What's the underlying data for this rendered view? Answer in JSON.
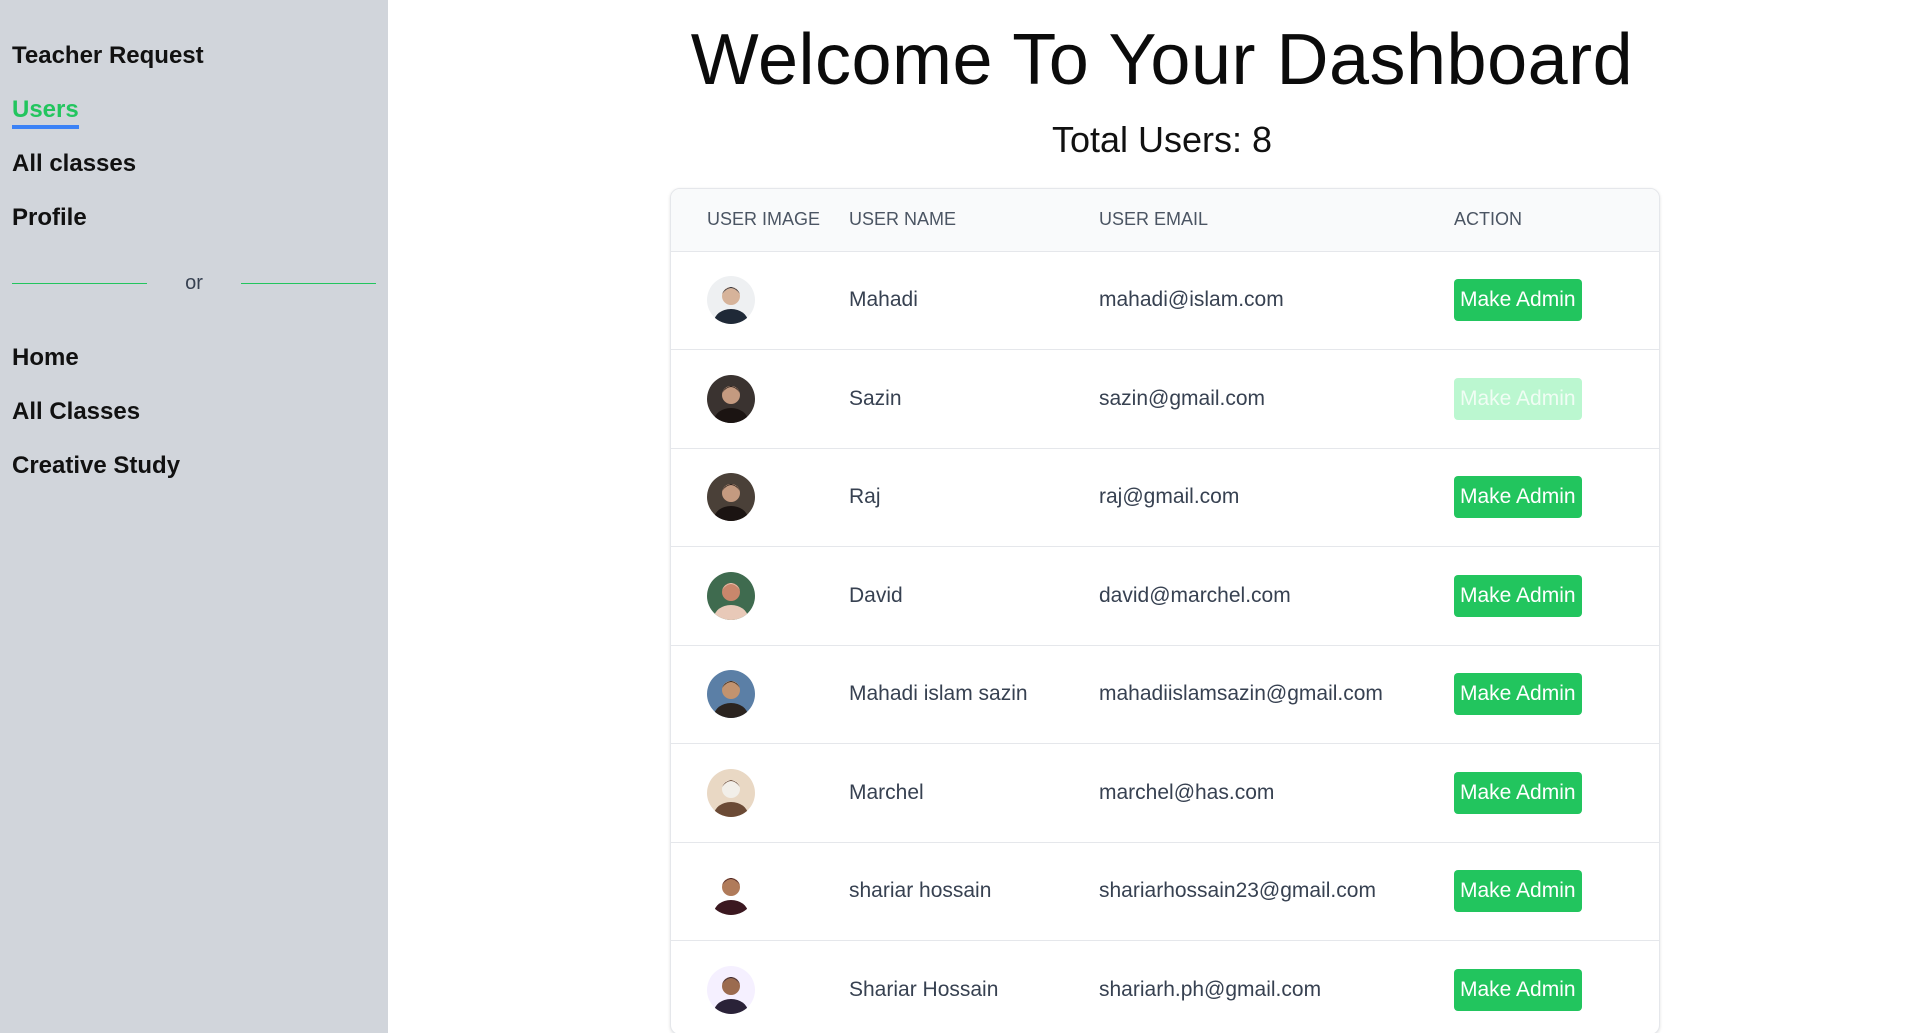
{
  "sidebar": {
    "items_top": [
      {
        "label": "Teacher Request",
        "active": false
      },
      {
        "label": "Users",
        "active": true
      },
      {
        "label": "All classes",
        "active": false
      },
      {
        "label": "Profile",
        "active": false
      }
    ],
    "divider_text": "or",
    "items_bottom": [
      {
        "label": "Home"
      },
      {
        "label": "All Classes"
      },
      {
        "label": "Creative Study"
      }
    ]
  },
  "main": {
    "title": "Welcome To Your Dashboard",
    "total_users": "Total Users: 8",
    "table": {
      "headers": [
        "USER IMAGE",
        "USER NAME",
        "USER EMAIL",
        "ACTION"
      ],
      "rows": [
        {
          "name": "Mahadi",
          "email": "mahadi@islam.com",
          "action": "Make Admin",
          "disabled": false,
          "avatar_colors": [
            "#eef0f2",
            "#1f2937",
            "#d6b39a"
          ]
        },
        {
          "name": "Sazin",
          "email": "sazin@gmail.com",
          "action": "Make Admin",
          "disabled": true,
          "avatar_colors": [
            "#3a3330",
            "#1b1412",
            "#c49a80"
          ]
        },
        {
          "name": "Raj",
          "email": "raj@gmail.com",
          "action": "Make Admin",
          "disabled": false,
          "avatar_colors": [
            "#4a4038",
            "#1b1412",
            "#c49a80"
          ]
        },
        {
          "name": "David",
          "email": "david@marchel.com",
          "action": "Make Admin",
          "disabled": false,
          "avatar_colors": [
            "#3f6b4f",
            "#e8c9b8",
            "#c9876c"
          ]
        },
        {
          "name": "Mahadi islam sazin",
          "email": "mahadiislamsazin@gmail.com",
          "action": "Make Admin",
          "disabled": false,
          "avatar_colors": [
            "#5b7fa6",
            "#2b2420",
            "#c2936f"
          ]
        },
        {
          "name": "Marchel",
          "email": "marchel@has.com",
          "action": "Make Admin",
          "disabled": false,
          "avatar_colors": [
            "#e9d8c4",
            "#6b4a35",
            "#f2efe9"
          ]
        },
        {
          "name": "shariar hossain",
          "email": "shariarhossain23@gmail.com",
          "action": "Make Admin",
          "disabled": false,
          "avatar_colors": [
            "#ffffff",
            "#3b1820",
            "#b07b5a"
          ]
        },
        {
          "name": "Shariar Hossain",
          "email": "shariarh.ph@gmail.com",
          "action": "Make Admin",
          "disabled": false,
          "avatar_colors": [
            "#f5f0ff",
            "#2a2238",
            "#9b6b4f"
          ]
        }
      ]
    }
  }
}
